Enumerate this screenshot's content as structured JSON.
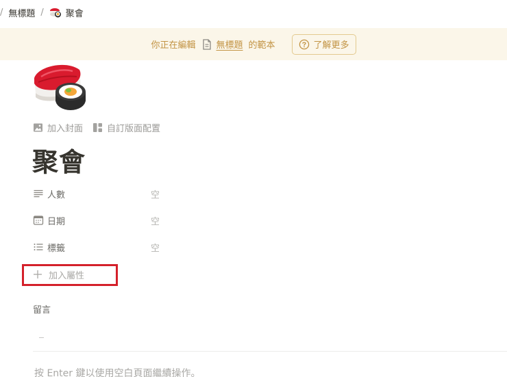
{
  "breadcrumb": {
    "separator": "/",
    "parent": "無標題",
    "current": "聚會",
    "current_icon": "sushi-icon"
  },
  "banner": {
    "prefix": "你正在編輯",
    "doc_icon": "document-icon",
    "link": "無標題",
    "suffix": "的範本",
    "learn_more": "了解更多",
    "learn_icon": "question-circle-icon"
  },
  "page": {
    "icon": "sushi-icon",
    "add_cover": "加入封面",
    "customize_layout": "自訂版面配置",
    "title": "聚會"
  },
  "properties": [
    {
      "icon": "text-lines-icon",
      "name": "人數",
      "value": "空"
    },
    {
      "icon": "calendar-icon",
      "name": "日期",
      "value": "空"
    },
    {
      "icon": "list-icon",
      "name": "標籤",
      "value": "空"
    }
  ],
  "add_property": "加入屬性",
  "comments_label": "留言",
  "hint": "按 Enter 鍵以使用空白頁面繼續操作。",
  "colors": {
    "banner_bg": "#fbf6e9",
    "banner_text": "#c29343",
    "highlight": "#d4202a",
    "text": "#37352f",
    "muted": "#9b9a97"
  }
}
